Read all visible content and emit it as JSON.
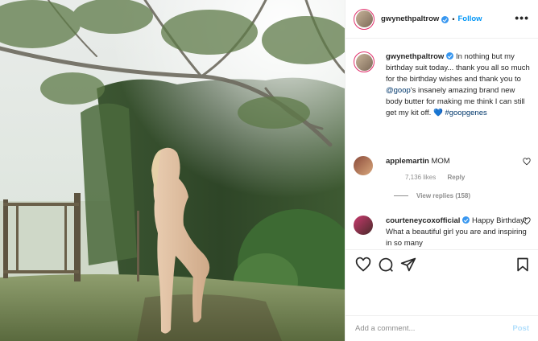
{
  "post": {
    "username": "gwynethpaltrow",
    "follow_label": "Follow",
    "separator": "•",
    "more_label": "•••",
    "caption_pre": "In nothing but my birthday suit today... thank you all so much for the birthday wishes and thank you to",
    "caption_mention": "@goop",
    "caption_post": "'s insanely amazing brand new body butter for making me think I can still get my kit off.",
    "caption_emoji": "💙",
    "caption_hashtag": "#goopgenes"
  },
  "comments": [
    {
      "username": "applemartin",
      "text": "MOM",
      "likes": "7,136 likes",
      "reply_label": "Reply",
      "view_replies": "View replies (158)"
    },
    {
      "username": "courteneycoxofficial",
      "text": "Happy Birthday! What a beautiful girl you are and inspiring in so many"
    }
  ],
  "add_comment": {
    "placeholder": "Add a comment...",
    "post_label": "Post"
  },
  "icons": {
    "like": "heart-icon",
    "comment": "comment-bubble-icon",
    "share": "paper-plane-icon",
    "save": "bookmark-icon",
    "more": "more-options-icon",
    "verified": "verified-badge-icon"
  },
  "colors": {
    "accent": "#0095f6",
    "verified": "#3897f0",
    "muted": "#8e8e8e",
    "post_disabled": "#b2dffc"
  }
}
